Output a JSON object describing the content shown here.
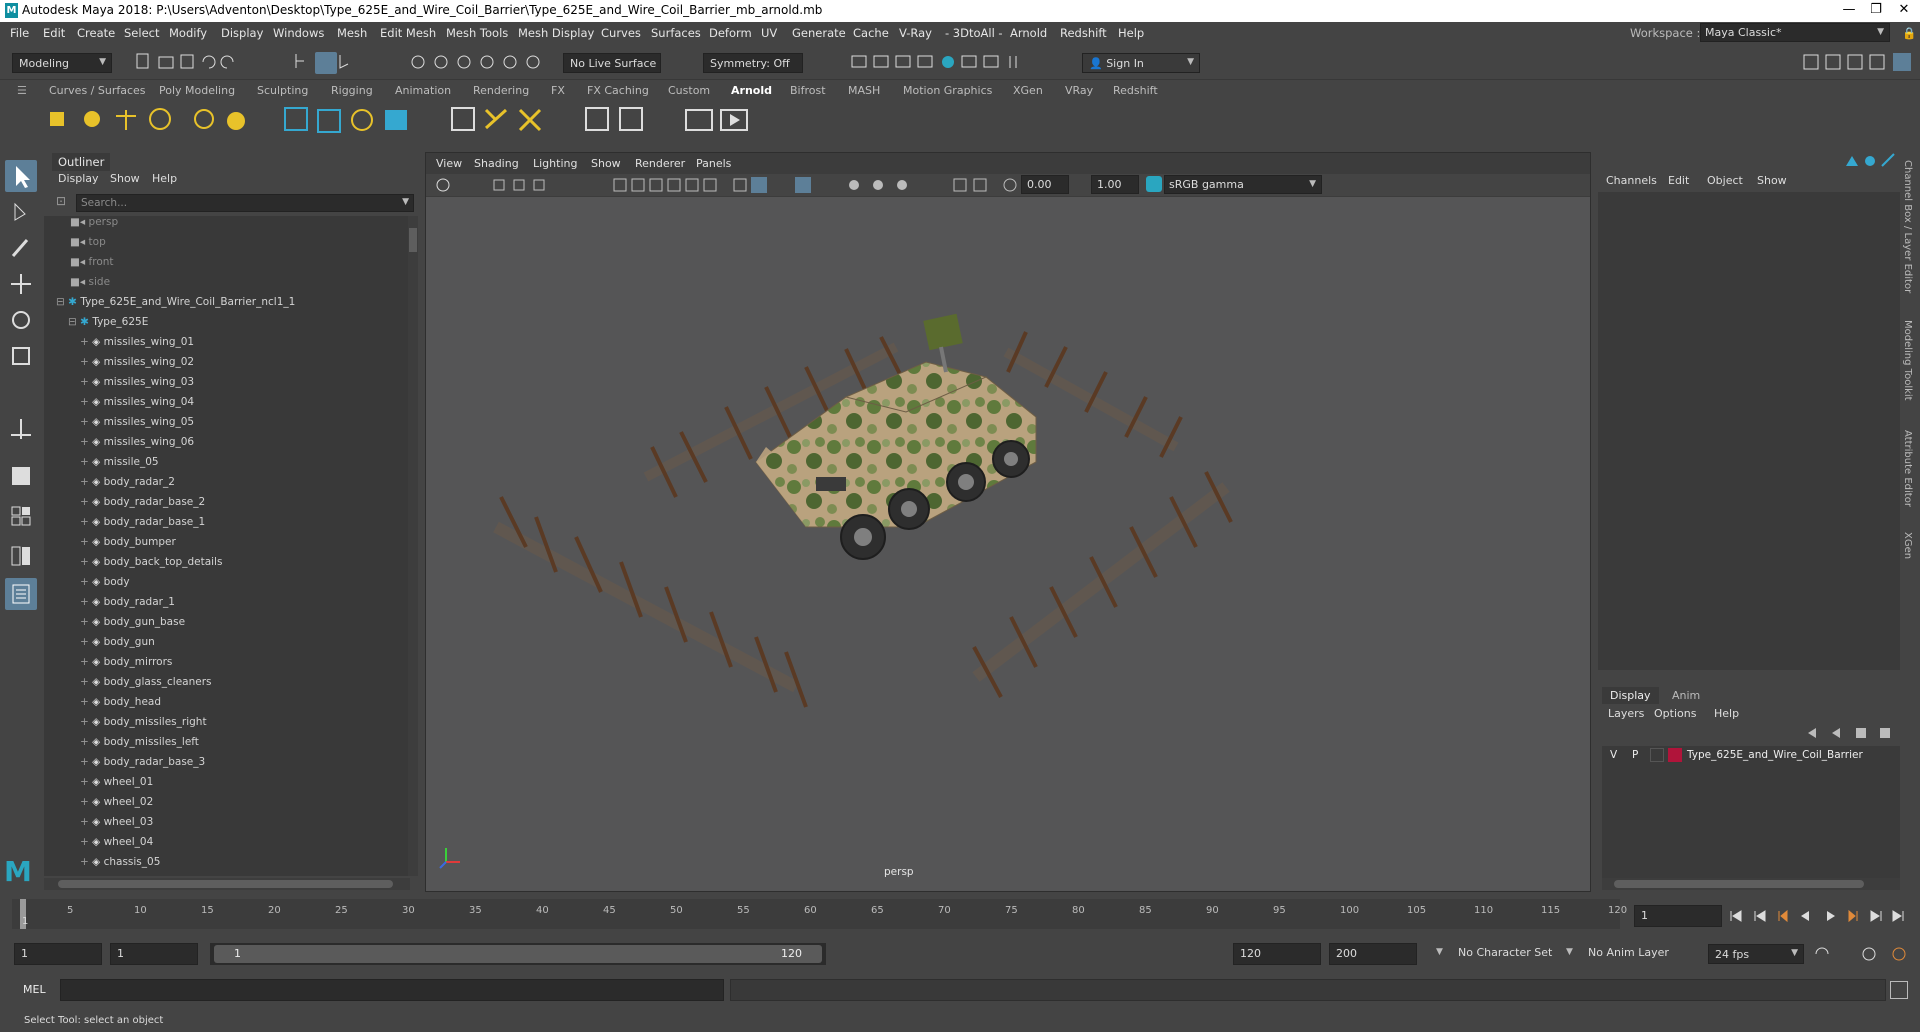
{
  "window": {
    "title": "Autodesk Maya 2018: P:\\Users\\Adventon\\Desktop\\Type_625E_and_Wire_Coil_Barrier\\Type_625E_and_Wire_Coil_Barrier_mb_arnold.mb"
  },
  "menubar": [
    "File",
    "Edit",
    "Create",
    "Select",
    "Modify",
    "Display",
    "Windows",
    "Mesh",
    "Edit Mesh",
    "Mesh Tools",
    "Mesh Display",
    "Curves",
    "Surfaces",
    "Deform",
    "UV",
    "Generate",
    "Cache",
    "V-Ray",
    "- 3DtoAll -",
    "Arnold",
    "Redshift",
    "Help"
  ],
  "workspace": {
    "label": "Workspace :",
    "value": "Maya Classic*"
  },
  "statusline": {
    "mode": "Modeling",
    "live_surface": "No Live Surface",
    "symmetry": "Symmetry: Off",
    "sign_in": "Sign In"
  },
  "shelf_tabs": [
    "Curves / Surfaces",
    "Poly Modeling",
    "Sculpting",
    "Rigging",
    "Animation",
    "Rendering",
    "FX",
    "FX Caching",
    "Custom",
    "Arnold",
    "Bifrost",
    "MASH",
    "Motion Graphics",
    "XGen",
    "VRay",
    "Redshift"
  ],
  "shelf_active": "Arnold",
  "outliner": {
    "title": "Outliner",
    "menu": [
      "Display",
      "Show",
      "Help"
    ],
    "search_placeholder": "Search...",
    "cameras": [
      "persp",
      "top",
      "front",
      "side"
    ],
    "group": "Type_625E_and_Wire_Coil_Barrier_ncl1_1",
    "subgroup": "Type_625E",
    "items": [
      "missiles_wing_01",
      "missiles_wing_02",
      "missiles_wing_03",
      "missiles_wing_04",
      "missiles_wing_05",
      "missiles_wing_06",
      "missile_05",
      "body_radar_2",
      "body_radar_base_2",
      "body_radar_base_1",
      "body_bumper",
      "body_back_top_details",
      "body",
      "body_radar_1",
      "body_gun_base",
      "body_gun",
      "body_mirrors",
      "body_glass_cleaners",
      "body_head",
      "body_missiles_right",
      "body_missiles_left",
      "body_radar_base_3",
      "wheel_01",
      "wheel_02",
      "wheel_03",
      "wheel_04",
      "chassis_05"
    ]
  },
  "viewport": {
    "menu": [
      "View",
      "Shading",
      "Lighting",
      "Show",
      "Renderer",
      "Panels"
    ],
    "field_a": "0.00",
    "field_b": "1.00",
    "color_space": "sRGB gamma",
    "camera_label": "persp"
  },
  "channelbox": {
    "menu": [
      "Channels",
      "Edit",
      "Object",
      "Show"
    ],
    "layer_tabs": [
      "Display",
      "Anim"
    ],
    "layer_menu": [
      "Layers",
      "Options",
      "Help"
    ],
    "layer": {
      "v": "V",
      "p": "P",
      "name": "Type_625E_and_Wire_Coil_Barrier",
      "color": "#b0143a"
    }
  },
  "side_tabs": [
    "Channel Box / Layer Editor",
    "Modeling Toolkit",
    "Attribute Editor",
    "XGen"
  ],
  "timeline": {
    "ticks": [
      "5",
      "10",
      "15",
      "20",
      "25",
      "30",
      "35",
      "40",
      "45",
      "50",
      "55",
      "60",
      "65",
      "70",
      "75",
      "80",
      "85",
      "90",
      "95",
      "100",
      "105",
      "110",
      "115",
      "120"
    ],
    "start_marker": "1",
    "current_frame": "1"
  },
  "range": {
    "start": "1",
    "anim_start": "1",
    "slider_start": "1",
    "slider_end": "120",
    "end": "120",
    "anim_end": "200",
    "character_set": "No Character Set",
    "anim_layer": "No Anim Layer",
    "fps": "24 fps"
  },
  "cmdline": {
    "label": "MEL"
  },
  "helpline": {
    "text": "Select Tool: select an object"
  }
}
